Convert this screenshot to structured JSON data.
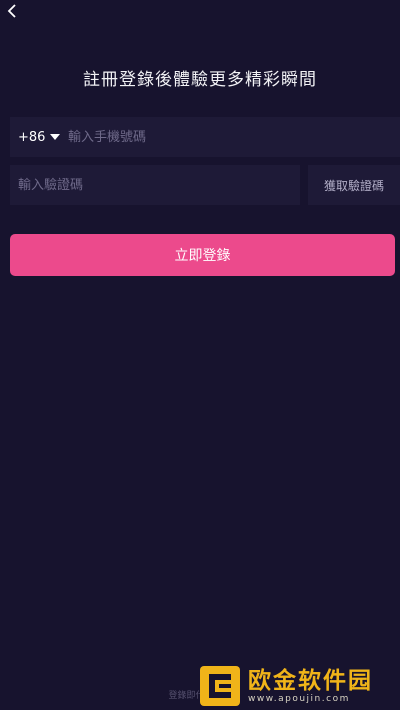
{
  "header": {
    "back_icon": "chevron-left-icon",
    "title": "註冊登錄後體驗更多精彩瞬間"
  },
  "phone": {
    "country_code": "+86",
    "placeholder": "輸入手機號碼",
    "value": ""
  },
  "verification": {
    "placeholder": "輸入驗證碼",
    "value": "",
    "get_code_label": "獲取驗證碼"
  },
  "login_button": {
    "label": "立即登錄"
  },
  "footer": {
    "agreement_text": "登錄即代表同意"
  },
  "watermark": {
    "title": "欧金软件园",
    "url": "www.apoujin.com"
  },
  "colors": {
    "background": "#17132e",
    "input_background": "#1e1a37",
    "accent": "#ec4a8c",
    "watermark": "#f0b419"
  }
}
